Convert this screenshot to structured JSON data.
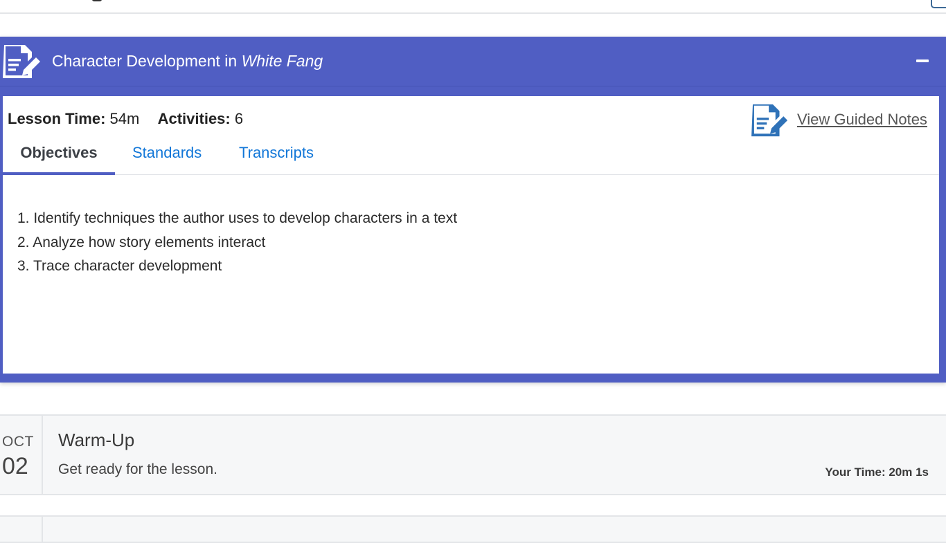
{
  "lesson": {
    "title_prefix": "Character Development in ",
    "title_emphasis": "White Fang",
    "lesson_time_label": "Lesson Time:",
    "lesson_time_value": "54m",
    "activities_label": "Activities:",
    "activities_value": "6",
    "guided_notes_label": "View Guided Notes",
    "tabs": [
      {
        "label": "Objectives",
        "active": true
      },
      {
        "label": "Standards",
        "active": false
      },
      {
        "label": "Transcripts",
        "active": false
      }
    ],
    "objectives": [
      "1. Identify techniques the author uses to develop characters in a text",
      "2. Analyze how story elements interact",
      "3. Trace character development"
    ]
  },
  "activities": [
    {
      "month": "OCT",
      "day": "02",
      "title": "Warm-Up",
      "description": "Get ready for the lesson.",
      "time": "Your Time: 20m 1s"
    }
  ],
  "icons": {
    "lesson_header": "document-edit-icon",
    "guided_notes": "document-edit-icon",
    "collapse": "minus-icon"
  },
  "colors": {
    "lesson_header_bg": "#505ec3",
    "link": "#1277d8",
    "guided_icon": "#2f72b8"
  }
}
